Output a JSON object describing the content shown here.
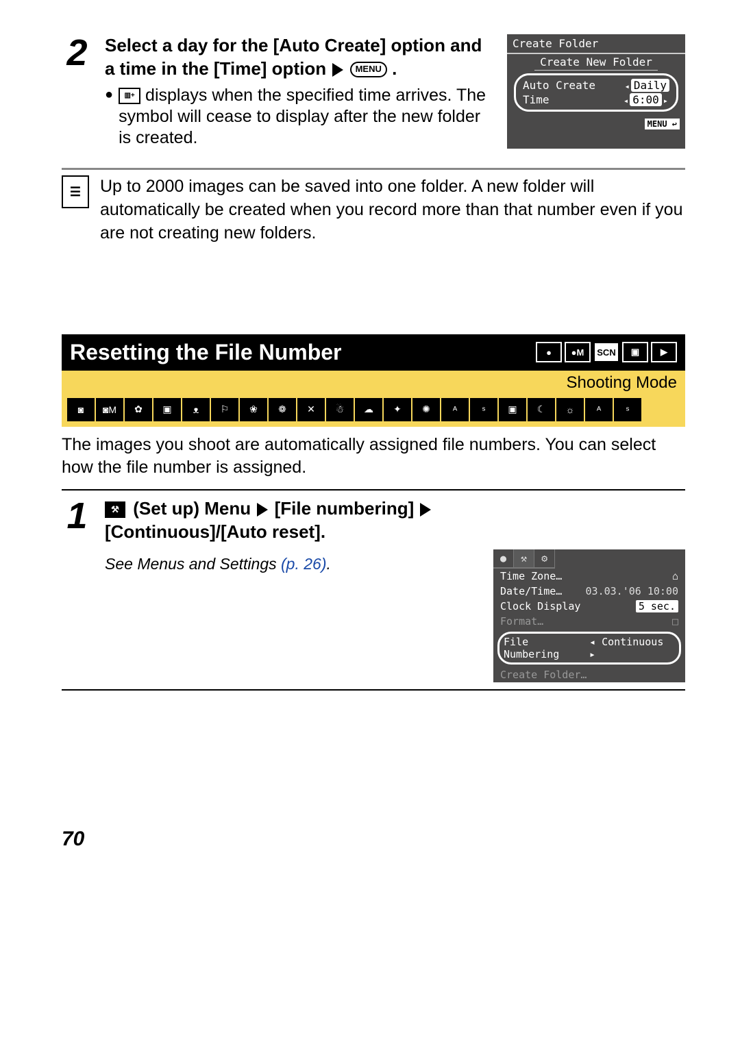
{
  "step2": {
    "number": "2",
    "heading_part1": "Select a day for the [Auto Create] option and a time in the [Time] option",
    "menu_label": "MENU",
    "bullet_text": " displays when the specified time arrives. The symbol will cease to display after the new folder is created."
  },
  "screen1": {
    "title": "Create Folder",
    "line1": "Create New Folder",
    "row_auto_label": "Auto Create",
    "row_auto_value": "Daily",
    "row_time_label": "Time",
    "row_time_value": "6:00",
    "menu_tag": "MENU"
  },
  "note": {
    "text": "Up to 2000 images can be saved into one folder. A new folder will automatically be created when you record more than that number even if you are not creating new folders."
  },
  "section": {
    "title": "Resetting the File Number",
    "shooting_mode_label": "Shooting Mode",
    "heading_icons": [
      "●",
      "●M",
      "SCN",
      "▣",
      "▶"
    ]
  },
  "intro": "The images you shoot are automatically assigned file numbers. You can select how the file number is assigned.",
  "step1": {
    "number": "1",
    "heading_segments": {
      "setup": "(Set up) Menu",
      "filenum": "[File numbering]",
      "rest": "[Continuous]/[Auto reset]."
    },
    "see_prefix": "See ",
    "see_italic": "Menus and Settings ",
    "see_page": "(p. 26)",
    "see_suffix": "."
  },
  "screen2": {
    "tabs": [
      "●",
      "⚒",
      "⚙"
    ],
    "rows": [
      {
        "label": "Time Zone…",
        "value": "⌂"
      },
      {
        "label": "Date/Time…",
        "value": "03.03.'06 10:00"
      },
      {
        "label": "Clock Display",
        "value": "5 sec."
      }
    ],
    "sel_label": "File Numbering",
    "sel_value": "Continuous"
  },
  "page_number": "70"
}
